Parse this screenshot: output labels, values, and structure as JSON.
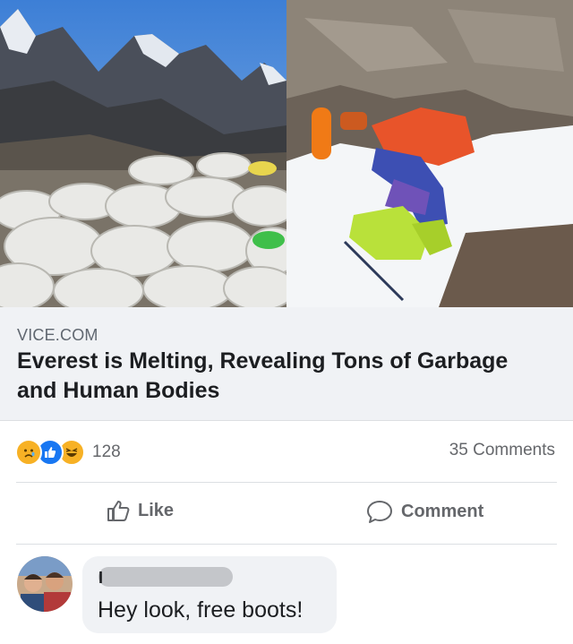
{
  "images": {
    "left_photo": "photo of bagged garbage at Everest base camp",
    "right_photo": "photo of climber's body on snow with green boots"
  },
  "link_preview": {
    "domain": "VICE.COM",
    "title": "Everest is Melting, Revealing Tons of Garbage and Human Bodies"
  },
  "stats": {
    "reaction_icons": [
      "sad-emoji-icon",
      "like-reaction-icon",
      "haha-emoji-icon"
    ],
    "reaction_count": "128",
    "comments": "35 Comments"
  },
  "actions": {
    "like_label": "Like",
    "comment_label": "Comment"
  },
  "comment": {
    "author_initial": "I",
    "text": "Hey look, free boots!"
  },
  "colors": {
    "preview_bg": "#f0f2f5",
    "secondary_text": "#65676b",
    "like_blue": "#1877f2",
    "reaction_yellow": "#f7b125"
  }
}
